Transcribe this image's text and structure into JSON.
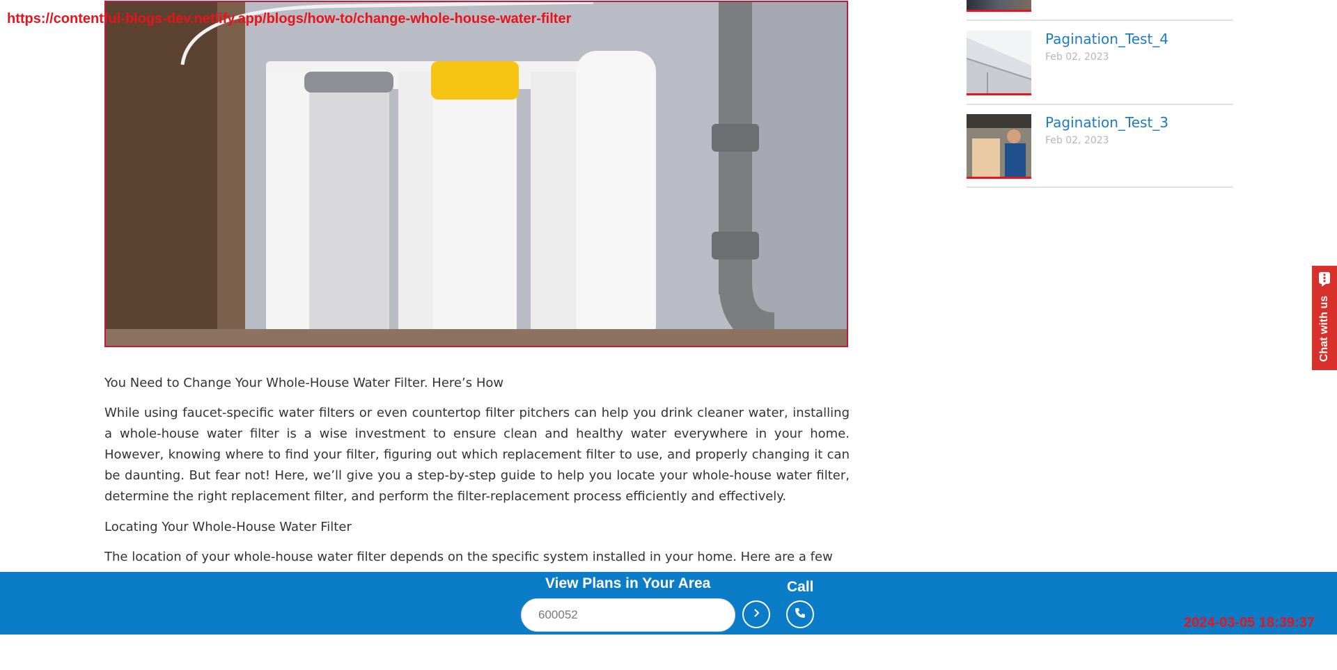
{
  "overlay": {
    "url": "https://contentful-blogs-dev.netlify.app/blogs/how-to/change-whole-house-water-filter",
    "timestamp": "2024-03-05 18:39:37"
  },
  "hero": {
    "image": "water-filter-cartridges-photo"
  },
  "article": {
    "heading1": "You Need to Change Your Whole-House Water Filter. Here’s How",
    "paragraph1": "While using faucet-specific water filters or even countertop filter pitchers can help you drink cleaner water, installing a whole-house water filter is a wise investment to ensure clean and healthy water everywhere in your home. However, knowing where to find your filter, figuring out which replacement filter to use, and properly changing it can be daunting. But fear not! Here, we’ll give you a step-by-step guide to help you locate your whole-house water filter, determine the right replacement filter, and perform the filter-replacement process efficiently and effectively.",
    "heading2": "Locating Your Whole-House Water Filter",
    "paragraph2": "The location of your whole-house water filter depends on the specific system installed in your home. Here are a few"
  },
  "sidebar": {
    "items": [
      {
        "title": "Pagination_Test_4",
        "date": "Feb 02, 2023",
        "image": "roof-gutter-photo"
      },
      {
        "title": "Pagination_Test_3",
        "date": "Feb 02, 2023",
        "image": "technician-appliance-photo"
      }
    ]
  },
  "chat": {
    "label": "Chat with us",
    "icon": "chat-bubble-icon"
  },
  "bottom_bar": {
    "plans_label": "View Plans in Your Area",
    "zip_value": "600052",
    "call_label": "Call",
    "go_icon": "chevron-right-icon",
    "call_icon": "phone-icon"
  },
  "colors": {
    "brand_blue": "#0b7dc8",
    "accent_red": "#e8141b",
    "link_blue": "#1b7bc4"
  }
}
